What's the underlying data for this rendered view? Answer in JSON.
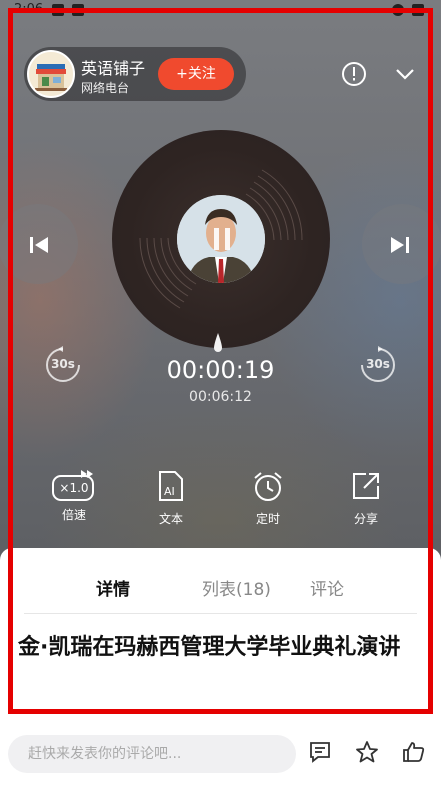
{
  "status_bar": {
    "time": "2:06"
  },
  "header": {
    "channel_name": "英语铺子",
    "channel_subtitle": "网络电台",
    "follow_label": "+关注"
  },
  "player": {
    "current_time": "00:00:19",
    "total_time": "00:06:12",
    "rewind_label": "30s",
    "forward_label": "30s",
    "speed_badge": "×1.0"
  },
  "tools": [
    {
      "label": "倍速",
      "icon": "speed-icon"
    },
    {
      "label": "文本",
      "icon": "ai-text-icon"
    },
    {
      "label": "定时",
      "icon": "alarm-clock-icon"
    },
    {
      "label": "分享",
      "icon": "share-icon"
    }
  ],
  "tabs": [
    {
      "label": "详情",
      "active": true
    },
    {
      "label": "列表(18)",
      "active": false
    },
    {
      "label": "评论",
      "active": false
    }
  ],
  "episode_title": "金·凯瑞在玛赫西管理大学毕业典礼演讲",
  "comment_placeholder": "赶快来发表你的评论吧...",
  "colors": {
    "accent": "#f04a2e",
    "frame": "#e50000"
  }
}
